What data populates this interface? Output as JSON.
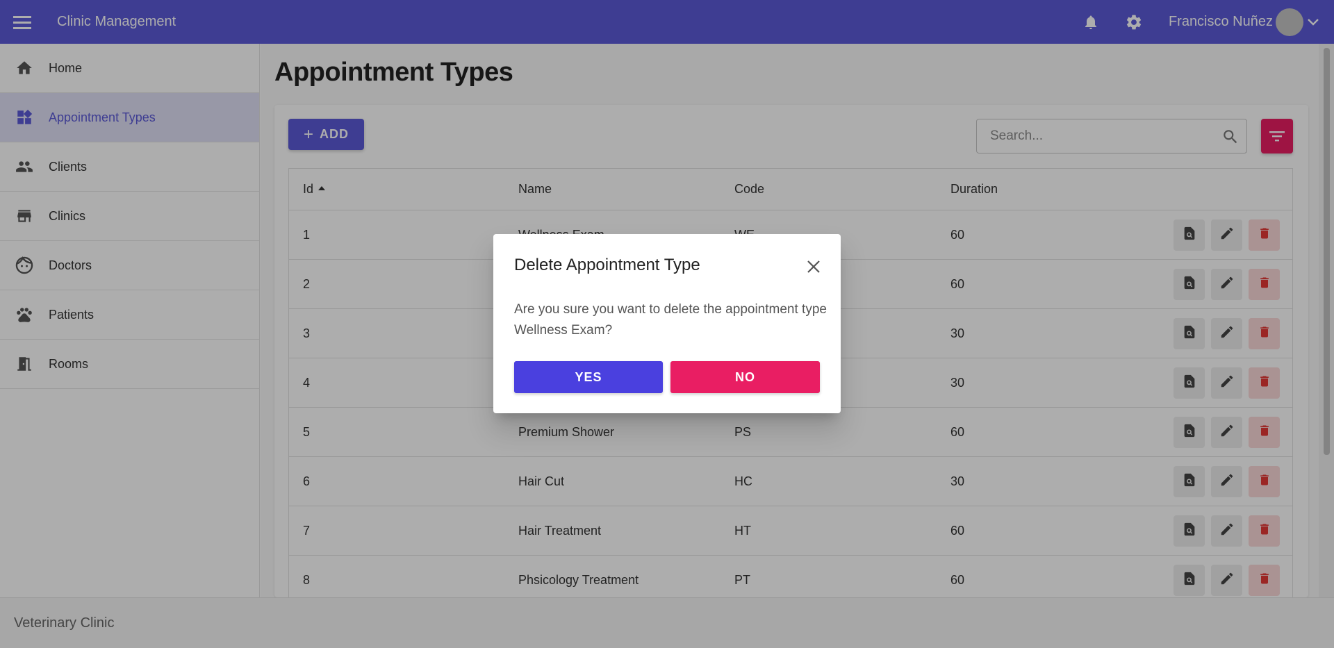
{
  "colors": {
    "primary": "#5c5ad8",
    "accent": "#e91e63",
    "danger_soft": "#fbd9d9"
  },
  "topbar": {
    "menu_icon": "hamburger-menu-icon",
    "title": "Clinic Management",
    "notifications_icon": "bell-icon",
    "settings_icon": "gear-icon",
    "user_name": "Francisco Nuñez",
    "dropdown_icon": "chevron-down-icon"
  },
  "sidebar": {
    "items": [
      {
        "label": "Home",
        "icon": "home-icon",
        "active": false
      },
      {
        "label": "Appointment Types",
        "icon": "dashboard-icon",
        "active": true
      },
      {
        "label": "Clients",
        "icon": "people-icon",
        "active": false
      },
      {
        "label": "Clinics",
        "icon": "store-icon",
        "active": false
      },
      {
        "label": "Doctors",
        "icon": "face-icon",
        "active": false
      },
      {
        "label": "Patients",
        "icon": "paw-icon",
        "active": false
      },
      {
        "label": "Rooms",
        "icon": "door-icon",
        "active": false
      }
    ]
  },
  "footer": {
    "text": "Veterinary Clinic"
  },
  "main": {
    "title": "Appointment Types",
    "add_label": "ADD",
    "search_placeholder": "Search...",
    "columns": [
      "Id",
      "Name",
      "Code",
      "Duration"
    ],
    "rows": [
      {
        "id": "1",
        "name": "Wellness Exam",
        "code": "WE",
        "duration": "60"
      },
      {
        "id": "2",
        "name": "",
        "code": "",
        "duration": "60"
      },
      {
        "id": "3",
        "name": "",
        "code": "",
        "duration": "30"
      },
      {
        "id": "4",
        "name": "",
        "code": "",
        "duration": "30"
      },
      {
        "id": "5",
        "name": "Premium Shower",
        "code": "PS",
        "duration": "60"
      },
      {
        "id": "6",
        "name": "Hair Cut",
        "code": "HC",
        "duration": "30"
      },
      {
        "id": "7",
        "name": "Hair Treatment",
        "code": "HT",
        "duration": "60"
      },
      {
        "id": "8",
        "name": "Phsicology Treatment",
        "code": "PT",
        "duration": "60"
      }
    ]
  },
  "dialog": {
    "title": "Delete Appointment Type",
    "message": "Are you sure you want to delete the appointment type Wellness Exam?",
    "yes_label": "YES",
    "no_label": "NO"
  }
}
